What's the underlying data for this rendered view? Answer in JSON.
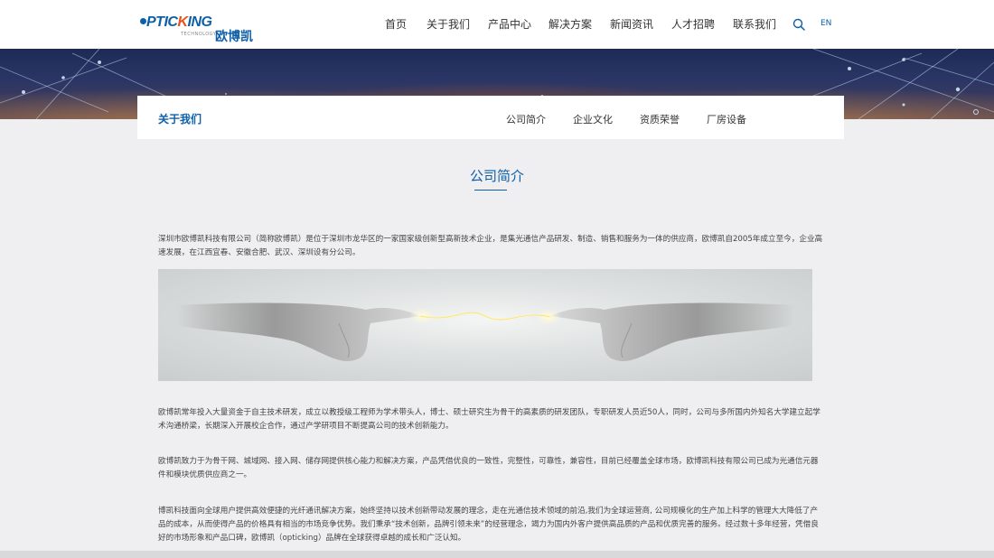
{
  "header": {
    "logo": {
      "brand_prefix": "PTIC",
      "brand_accent": "K",
      "brand_suffix": "ING",
      "tagline": "TECHNOLOGY",
      "name_cn": "欧博凯"
    },
    "nav": [
      {
        "label": "首页"
      },
      {
        "label": "关于我们"
      },
      {
        "label": "产品中心"
      },
      {
        "label": "解决方案"
      },
      {
        "label": "新闻资讯"
      },
      {
        "label": "人才招聘"
      },
      {
        "label": "联系我们"
      }
    ],
    "search_icon": "search-icon",
    "lang": "EN"
  },
  "subnav": {
    "title": "关于我们",
    "items": [
      {
        "label": "公司简介"
      },
      {
        "label": "企业文化"
      },
      {
        "label": "资质荣誉"
      },
      {
        "label": "厂房设备"
      }
    ]
  },
  "content": {
    "title": "公司简介",
    "paragraphs": [
      "深圳市欧博凯科技有限公司（简称欧博凯）是位于深圳市龙华区的一家国家级创新型高新技术企业，是集光通信产品研发、制造、销售和服务为一体的供应商，欧博凯自2005年成立至今，企业高速发展，在江西宜春、安徽合肥、武汉、深圳设有分公司。",
      "欧博凯常年投入大量资金于自主技术研发，成立以教授级工程师为学术带头人，博士、硕士研究生为骨干的高素质的研发团队，专职研发人员近50人，同时，公司与多所国内外知名大学建立起学术沟通桥梁，长期深入开展校企合作，通过产学研项目不断提高公司的技术创新能力。",
      "欧博凯致力于为骨干网、城域网、接入网、储存网提供核心能力和解决方案，产品凭借优良的一致性，完整性，可靠性，兼容性，目前已经覆盖全球市场，欧博凯科技有限公司已成为光通信元器件和模块优质供应商之一。",
      "博凯科技面向全球用户提供高效便捷的光纤通讯解决方案，始终坚持以技术创新带动发展的理念，走在光通信技术领域的前沿,我们为全球运营商, 公司规模化的生产加上科学的管理大大降低了产品的成本，从而使得产品的价格具有相当的市场竞争优势。我们秉承“技术创新，品牌引领未来”的经营理念，竭力为国内外客户提供高品质的产品和优质完善的服务。经过数十多年经营，凭借良好的市场形象和产品口碑，欧博凯（opticking）品牌在全球获得卓越的成长和广泛认知。"
    ]
  },
  "colors": {
    "brand_blue": "#0d5fa8",
    "brand_orange": "#e8521c",
    "page_bg": "#efeff2"
  }
}
